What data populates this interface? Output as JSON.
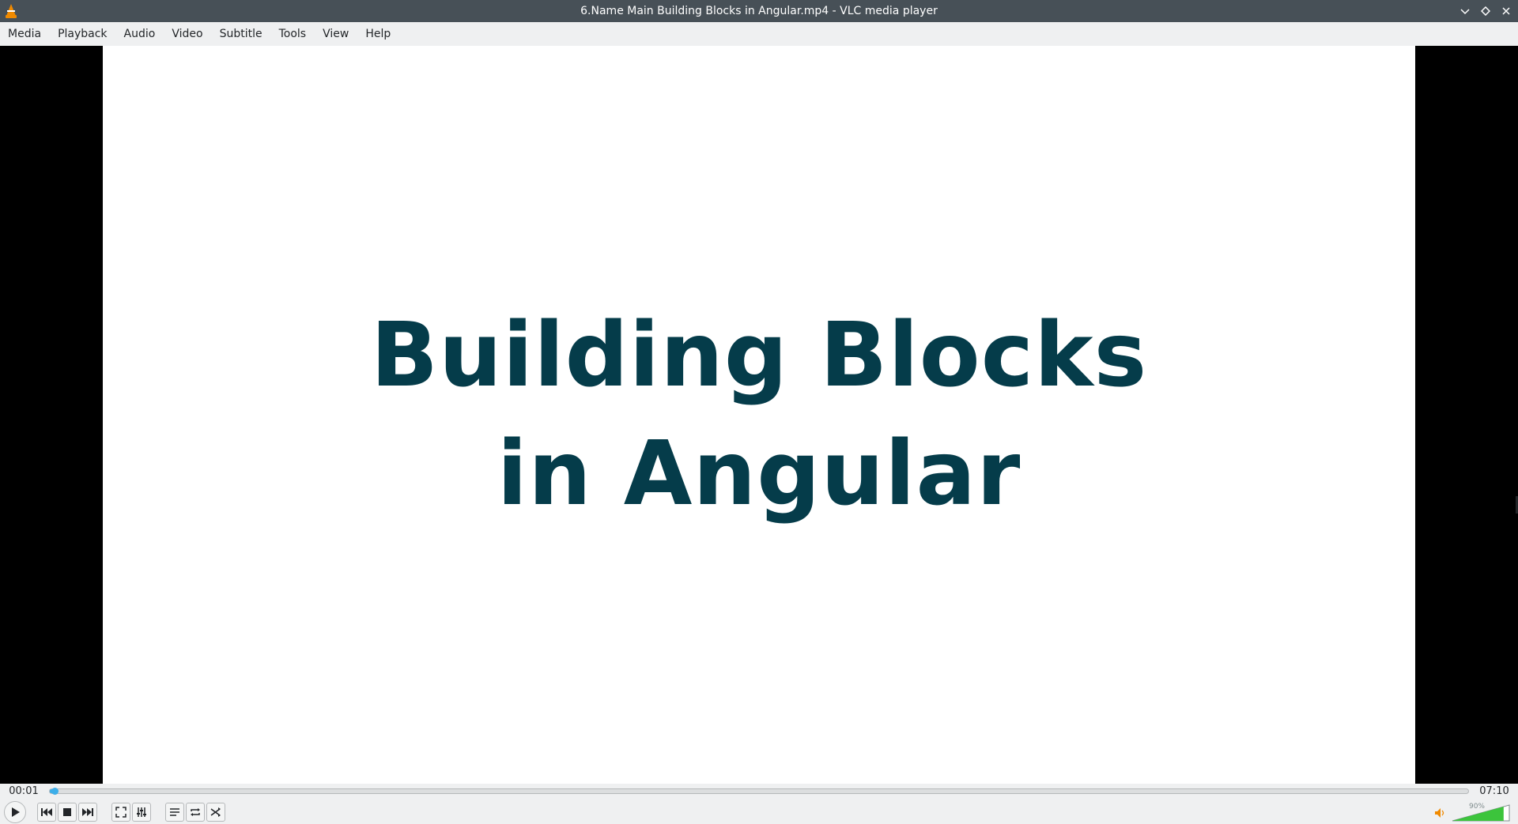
{
  "window": {
    "title": "6.Name Main Building Blocks in Angular.mp4 - VLC media player"
  },
  "menu": {
    "items": [
      "Media",
      "Playback",
      "Audio",
      "Video",
      "Subtitle",
      "Tools",
      "View",
      "Help"
    ]
  },
  "video": {
    "title_line1": "Building Blocks",
    "title_line2": "in Angular",
    "title_color": "#053c4a"
  },
  "playback": {
    "elapsed": "00:01",
    "total": "07:10",
    "progress_percent": 0.2
  },
  "volume": {
    "label": "90%",
    "level_percent": 90
  },
  "colors": {
    "titlebar": "#475057",
    "accent": "#3daee9",
    "volume_fill": "#3cc43c"
  },
  "icons": {
    "app": "vlc-cone-icon",
    "minimize": "chevron-down-icon",
    "maximize": "diamond-icon",
    "close": "close-icon",
    "play": "play-icon",
    "previous": "skip-back-icon",
    "stop": "stop-icon",
    "next": "skip-forward-icon",
    "fullscreen": "fullscreen-icon",
    "extended": "equalizer-icon",
    "playlist": "playlist-icon",
    "loop": "loop-icon",
    "shuffle": "shuffle-icon",
    "mute": "speaker-icon"
  }
}
